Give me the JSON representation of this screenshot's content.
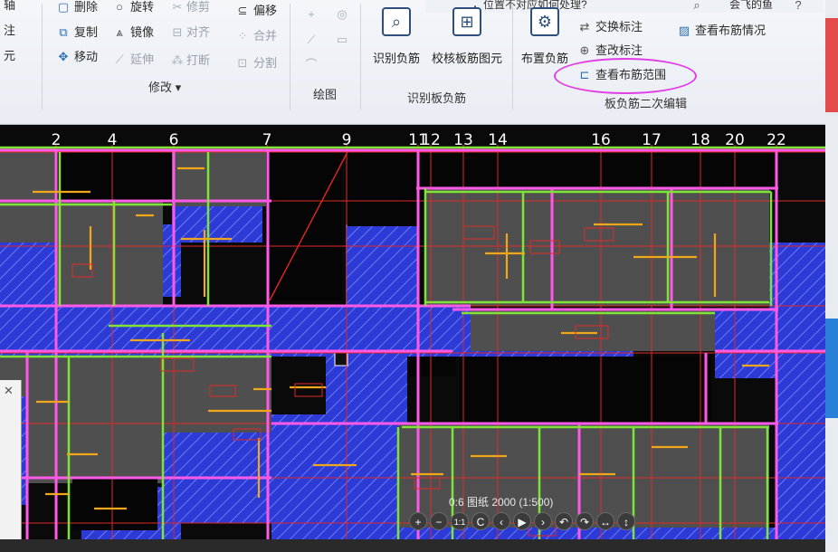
{
  "ribbon": {
    "left_cut": [
      "轴",
      "注",
      "元"
    ],
    "modify": {
      "delete": "删除",
      "rotate": "旋转",
      "trim": "修剪",
      "offset": "偏移",
      "copy": "复制",
      "mirror": "镜像",
      "align": "对齐",
      "merge": "合并",
      "move": "移动",
      "extend": "延伸",
      "break": "打断",
      "split": "分割",
      "group_label": "修改 ▾"
    },
    "draw": {
      "group_label": "绘图"
    },
    "identify": {
      "identify_neg": "识别负筋",
      "verify_slab": "校核板筋图元",
      "group_label": "识别板负筋"
    },
    "secondary": {
      "layout_neg": "布置负筋",
      "swap_label": "交换标注",
      "check_label": "查改标注",
      "view_layout": "查看布筋情况",
      "view_range": "查看布筋范围",
      "group_label": "板负筋二次编辑"
    },
    "top_partial": "，位置不对应如何处理?",
    "top_user": "会飞的鱼"
  },
  "axis_numbers": [
    "2",
    "4",
    "6",
    "7",
    "9",
    "11",
    "12",
    "13",
    "14",
    "16",
    "17",
    "18",
    "20",
    "22"
  ],
  "status": {
    "text": "0:6   图纸  2000  (1:500)"
  },
  "nav_buttons": [
    "+",
    "−",
    "1:1",
    "C",
    "‹",
    "▶",
    "›",
    "↶",
    "↷",
    "↔",
    "↕"
  ],
  "colors": {
    "slab_fill": "#2c3ad6",
    "beam": "#ff59e8",
    "rebar": "#f0a71a",
    "wall": "#7fe338",
    "axis": "#e02828",
    "highlight": "#e23ce6"
  }
}
